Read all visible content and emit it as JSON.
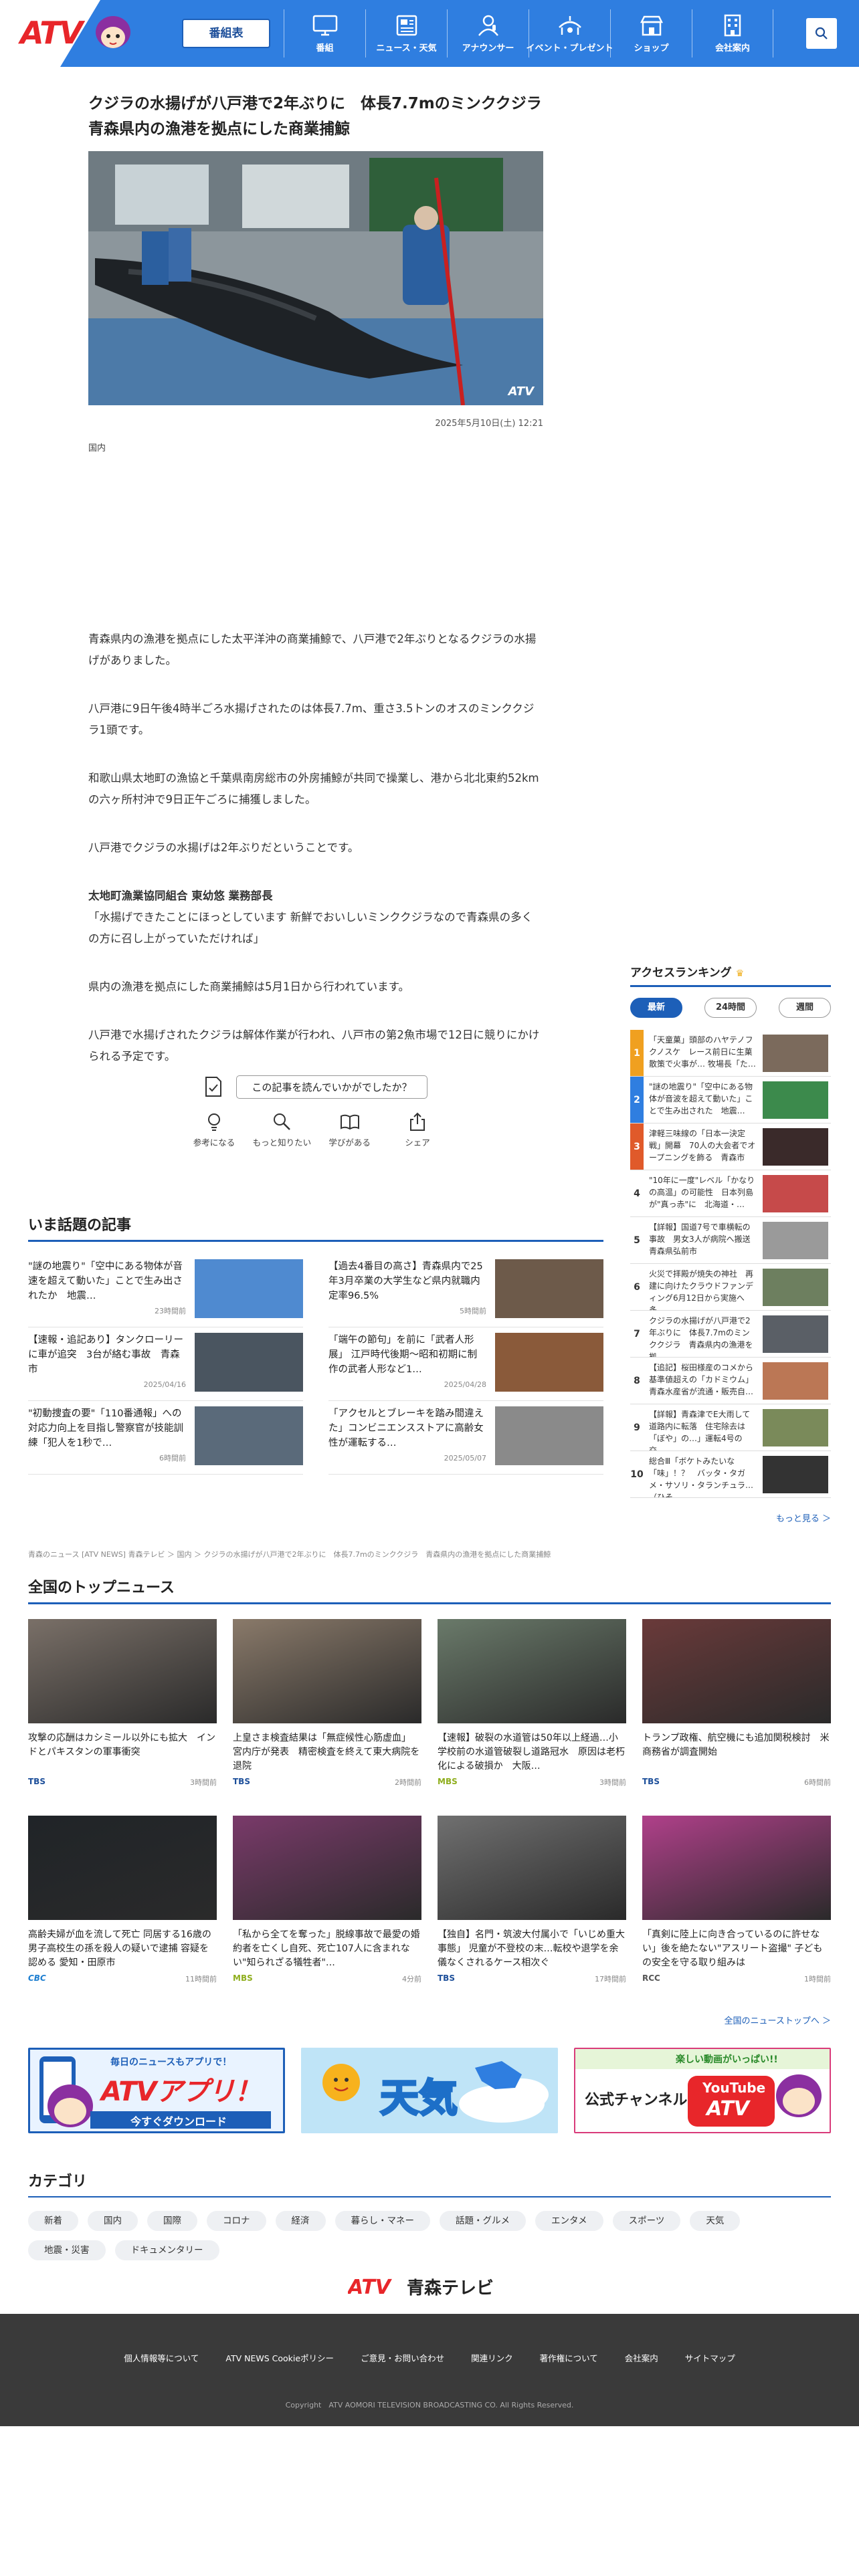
{
  "header": {
    "logo": "ATV",
    "bangumi_label": "番組表",
    "nav": [
      {
        "label": "番組",
        "icon": "tv-icon"
      },
      {
        "label": "ニュース・天気",
        "icon": "news-icon"
      },
      {
        "label": "アナウンサー",
        "icon": "announcer-icon"
      },
      {
        "label": "イベント・プレゼント",
        "icon": "event-icon"
      },
      {
        "label": "ショップ",
        "icon": "shop-icon"
      },
      {
        "label": "会社案内",
        "icon": "building-icon"
      }
    ],
    "search_icon": "search-icon",
    "brand_color": "#2f7ee0"
  },
  "article": {
    "title": "クジラの水揚げが八戸港で2年ぶりに　体長7.7mのミンククジラ　青森県内の漁港を拠点にした商業捕鯨",
    "watermark": "ATV",
    "date": "2025年5月10日(土) 12:21",
    "category": "国内",
    "paragraphs": [
      "青森県内の漁港を拠点にした太平洋沖の商業捕鯨で、八戸港で2年ぶりとなるクジラの水揚げがありました。",
      "八戸港に9日午後4時半ごろ水揚げされたのは体長7.7m、重さ3.5トンのオスのミンククジラ1頭です。",
      "和歌山県太地町の漁協と千葉県南房総市の外房捕鯨が共同で操業し、港から北北東約52kmの六ヶ所村沖で9日正午ごろに捕獲しました。",
      "八戸港でクジラの水揚げは2年ぶりだということです。"
    ],
    "speaker": "太地町漁業協同組合 東幼悠 業務部長",
    "quote": "「水揚げできたことにほっとしています 新鮮でおいしいミンククジラなので青森県の多くの方に召し上がっていただければ」",
    "paragraphs_after": [
      "県内の漁港を拠点にした商業捕鯨は5月1日から行われています。",
      "八戸港で水揚げされたクジラは解体作業が行われ、八戸市の第2魚市場で12日に競りにかけられる予定です。"
    ],
    "feedback_label": "この記事を読んでいかがでしたか？",
    "reactions": [
      {
        "label": "参考になる",
        "icon": "lightbulb-icon"
      },
      {
        "label": "もっと知りたい",
        "icon": "magnifier-icon"
      },
      {
        "label": "学びがある",
        "icon": "book-icon"
      },
      {
        "label": "シェア",
        "icon": "share-icon"
      }
    ]
  },
  "ranking": {
    "title": "アクセスランキング",
    "crown_icon": "crown-icon",
    "tabs": [
      "最新",
      "24時間",
      "週間"
    ],
    "items": [
      {
        "rank": "1",
        "text": "「天童菓」頭部のハヤテノフクノスケ　レース前日に生菓散策で火事が… 牧場長「た…",
        "thumb": "#7b6a5c"
      },
      {
        "rank": "2",
        "text": "\"謎の地震り\"「空中にある物体が音波を超えて動いた」ことで生み出された　地震…",
        "thumb": "#3c8a4c"
      },
      {
        "rank": "3",
        "text": "津軽三味線の「日本一決定戦」開幕　70人の大会者でオープニングを飾る　青森市",
        "thumb": "#3a2a2a"
      },
      {
        "rank": "4",
        "text": "\"10年に一度\"レベル「かなりの高温」の可能性　日本列島が\"真っ赤\"に　北海道・…",
        "thumb": "#c64a4a"
      },
      {
        "rank": "5",
        "text": "【詳報】国道7号で車横転の事故　男女3人が病院へ搬送　青森県弘前市",
        "thumb": "#9a9a9a"
      },
      {
        "rank": "6",
        "text": "火災で拝殿が焼失の神社　再建に向けたクラウドファンディング6月12日から実施へ　多…",
        "thumb": "#6d7f5f"
      },
      {
        "rank": "7",
        "text": "クジラの水揚げが八戸港で2年ぶりに　体長7.7mのミンククジラ　青森県内の漁港を拠…",
        "thumb": "#5a5f66"
      },
      {
        "rank": "8",
        "text": "【追記】桜田様産のコメから基準値超えの「カドミウム」青森水産省が流通・販売自…",
        "thumb": "#bb7755"
      },
      {
        "rank": "9",
        "text": "【詳報】青森津でE大雨して道路内に転落　住宅除去は「ぼや」の…」運転4号の交…",
        "thumb": "#7a8a5a"
      },
      {
        "rank": "10",
        "text": "総合Ⅲ「ボケトみたいな「味」！？　バッタ・タガメ・サソリ・タランチュラ…（ひそ…",
        "thumb": "#333333"
      }
    ],
    "more": "もっと見る ＞"
  },
  "trending": {
    "title": "いま話題の記事",
    "items": [
      {
        "title": "\"謎の地震り\"「空中にある物体が音速を超えて動いた」ことで生み出されたか　地震…",
        "date": "23時間前",
        "thumb": "#4f8ad0"
      },
      {
        "title": "【過去4番目の高さ】青森県内で25年3月卒業の大学生など県内就職内定率96.5%",
        "date": "5時間前",
        "thumb": "#6d5a4a"
      },
      {
        "title": "【速報・追記あり】タンクローリーに車が追突　3台が絡む事故　青森市",
        "date": "2025/04/16",
        "thumb": "#4a5560"
      },
      {
        "title": "「端午の節句」を前に「武者人形展」 江戸時代後期〜昭和初期に制作の武者人形など1…",
        "date": "2025/04/28",
        "thumb": "#8a5a3a"
      },
      {
        "title": "\"初動捜査の要\"「110番通報」への対応力向上を目指し警察官が技能訓練「犯人を1秒で…",
        "date": "6時間前",
        "thumb": "#5a6a7a"
      },
      {
        "title": "「アクセルとブレーキを踏み間違えた」コンビニエンスストアに高齢女性が運転する…",
        "date": "2025/05/07",
        "thumb": "#8a8a8a"
      }
    ]
  },
  "breadcrumb": "青森のニュース [ATV NEWS] 青森テレビ ＞ 国内 ＞ クジラの水揚げが八戸港で2年ぶりに　体長7.7mのミンククジラ　青森県内の漁港を拠点にした商業捕鯨",
  "national": {
    "title": "全国のトップニュース",
    "items": [
      {
        "title": "攻撃の応酬はカシミール以外にも拡大　インドとパキスタンの軍事衝突",
        "source": "TBS",
        "src_class": "tbs",
        "date": "3時間前",
        "thumb": "#7a7068"
      },
      {
        "title": "上皇さま検査結果は「無症候性心筋虚血」 宮内庁が発表　精密検査を終えて東大病院を退院",
        "source": "TBS",
        "src_class": "tbs",
        "date": "2時間前",
        "thumb": "#8a7a6a"
      },
      {
        "title": "【速報】破裂の水道管は50年以上経過…小学校前の水道管破裂し道路冠水　原因は老朽化による破損か　大阪…",
        "source": "MBS",
        "src_class": "mbs",
        "date": "3時間前",
        "thumb": "#6a7a6a"
      },
      {
        "title": "トランプ政権、航空機にも追加関税検討　米商務省が調査開始",
        "source": "TBS",
        "src_class": "tbs",
        "date": "6時間前",
        "thumb": "#6a3a3a"
      },
      {
        "title": "高齢夫婦が血を流して死亡 同居する16歳の男子高校生の孫を殺人の疑いで逮捕 容疑を認める 愛知・田原市",
        "source": "CBC",
        "src_class": "cbc",
        "date": "11時間前",
        "thumb": "#202428"
      },
      {
        "title": "「私から全てを奪った」脱線事故で最愛の婚約者を亡くし自死、死亡107人に含まれない\"知られざる犠牲者\"…",
        "source": "MBS",
        "src_class": "mbs",
        "date": "4分前",
        "thumb": "#7a3a6a"
      },
      {
        "title": "【独自】名門・筑波大付属小で「いじめ重大事態」 児童が不登校の末…転校や退学を余儀なくされるケース相次ぐ",
        "source": "TBS",
        "src_class": "tbs",
        "date": "17時間前",
        "thumb": "#707070"
      },
      {
        "title": "「真剣に陸上に向き合っているのに許せない」後を絶たない\"アスリート盗撮\" 子どもの安全を守る取り組みは",
        "source": "RCC",
        "src_class": "rcc",
        "date": "1時間前",
        "thumb": "#b0408a"
      }
    ],
    "more": "全国のニューストップへ ＞"
  },
  "banners": [
    {
      "line1": "毎日のニュースもアプリで！",
      "line2": "ATVアプリ！",
      "line3": "今すぐダウンロード"
    },
    {
      "line1": "天気"
    },
    {
      "line1": "楽しい動画がいっぱい!!",
      "line2": "公式チャンネル",
      "line3": "YouTube",
      "line4": "ATV"
    }
  ],
  "categories": {
    "title": "カテゴリ",
    "items": [
      "新着",
      "国内",
      "国際",
      "コロナ",
      "経済",
      "暮らし・マネー",
      "話題・グルメ",
      "エンタメ",
      "スポーツ",
      "天気",
      "地震・災害",
      "ドキュメンタリー"
    ]
  },
  "footer_logo": {
    "mark": "ATV",
    "name": "青森テレビ"
  },
  "footer": {
    "links": [
      "個人情報等について",
      "ATV NEWS Cookieポリシー",
      "ご意見・お問い合わせ",
      "関連リンク",
      "著作権について",
      "会社案内",
      "サイトマップ"
    ],
    "copyright": "Copyright　ATV AOMORI TELEVISION BROADCASTING CO. All Rights Reserved."
  }
}
